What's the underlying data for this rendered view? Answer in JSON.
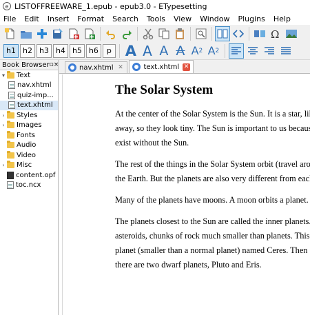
{
  "window": {
    "title": "LISTOFFREEWARE_1.epub - epub3.0 - ETypesetting"
  },
  "menu": [
    "File",
    "Edit",
    "Insert",
    "Format",
    "Search",
    "Tools",
    "View",
    "Window",
    "Plugins",
    "Help"
  ],
  "heading_buttons": [
    "h1",
    "h2",
    "h3",
    "h4",
    "h5",
    "h6",
    "p"
  ],
  "book_browser": {
    "title": "Book Browser",
    "items": [
      {
        "label": "Text",
        "type": "folder",
        "expanded": true
      },
      {
        "label": "nav.xhtml",
        "type": "file"
      },
      {
        "label": "quiz-imp...",
        "type": "file"
      },
      {
        "label": "text.xhtml",
        "type": "file",
        "selected": true
      },
      {
        "label": "Styles",
        "type": "folder"
      },
      {
        "label": "Images",
        "type": "folder"
      },
      {
        "label": "Fonts",
        "type": "folder"
      },
      {
        "label": "Audio",
        "type": "folder"
      },
      {
        "label": "Video",
        "type": "folder"
      },
      {
        "label": "Misc",
        "type": "folder"
      },
      {
        "label": "content.opf",
        "type": "opf"
      },
      {
        "label": "toc.ncx",
        "type": "file"
      }
    ]
  },
  "tabs": [
    {
      "label": "nav.xhtml",
      "active": false
    },
    {
      "label": "text.xhtml",
      "active": true
    }
  ],
  "document": {
    "heading": "The Solar System",
    "paragraphs": [
      [
        "At the center of the Solar System is the Sun. It is a star, like",
        "away, so they look tiny. The Sun is important to us because",
        "exist without the Sun."
      ],
      [
        "The rest of the things in the Solar System orbit (travel aroun",
        "the Earth. But the planets are also very different from each o"
      ],
      [
        "Many of the planets have moons. A moon orbits a planet. M"
      ],
      [
        "The planets closest to the Sun are called the inner planets. T",
        "asteroids, chunks of rock much smaller than planets. This rin",
        "planet (smaller than a normal planet) named Ceres. Then co",
        "there are two dwarf planets, Pluto and Eris."
      ]
    ]
  },
  "colors": {
    "accent": "#2e6fb5",
    "close_tab": "#e2523f",
    "selected_row": "#d9e8f7"
  }
}
